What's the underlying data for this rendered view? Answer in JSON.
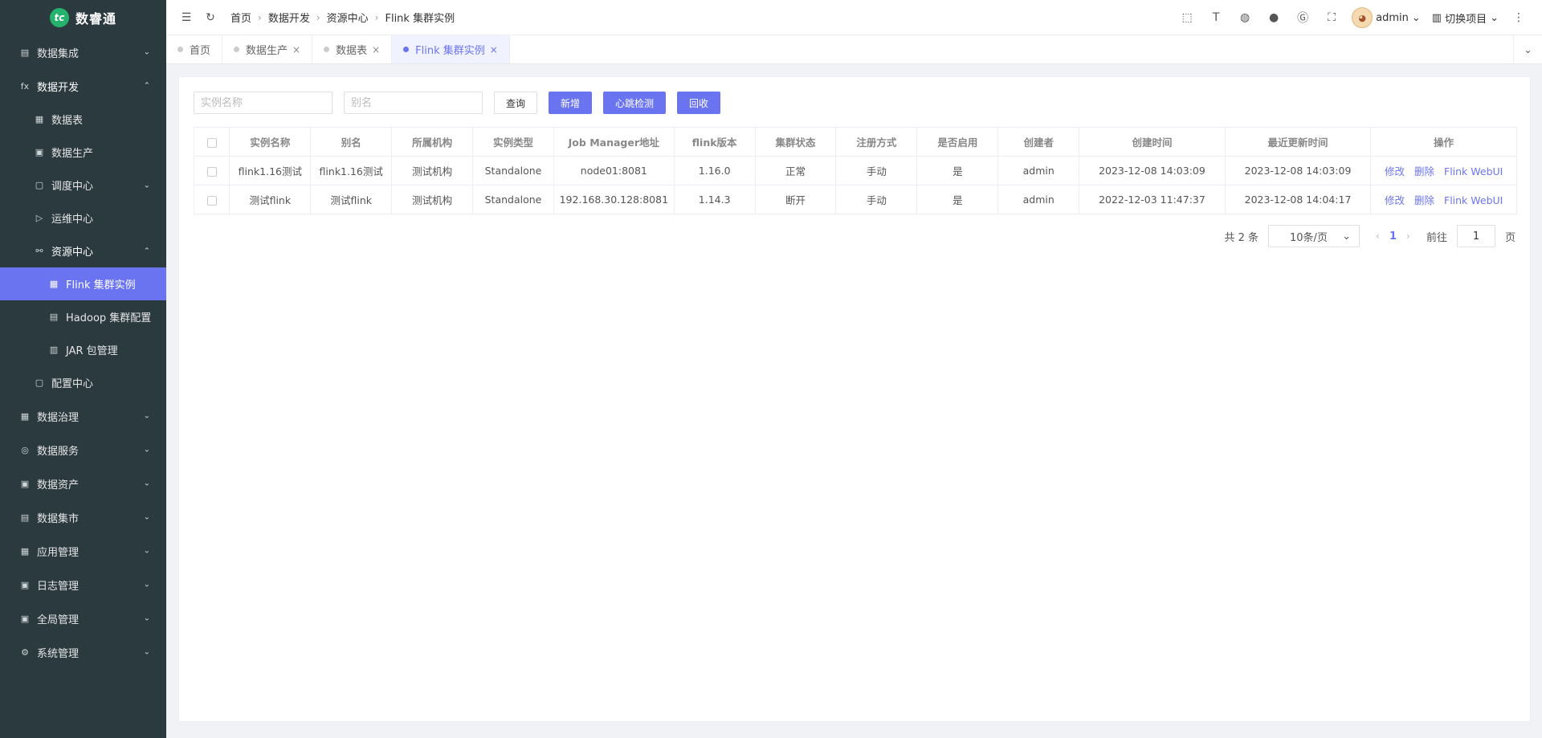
{
  "app": {
    "logo_mark": "tc",
    "name": "数睿通"
  },
  "sidebar": {
    "items": [
      {
        "label": "数据集成",
        "icon": "grid-icon",
        "glyph": "▤",
        "level": 1,
        "chevron": "down"
      },
      {
        "label": "数据开发",
        "icon": "function-icon",
        "glyph": "fx",
        "level": 1,
        "chevron": "up",
        "open": true
      },
      {
        "label": "数据表",
        "icon": "table-icon",
        "glyph": "▦",
        "level": 2
      },
      {
        "label": "数据生产",
        "icon": "monitor-icon",
        "glyph": "▣",
        "level": 2
      },
      {
        "label": "调度中心",
        "icon": "calendar-icon",
        "glyph": "▢",
        "level": 2,
        "chevron": "down"
      },
      {
        "label": "运维中心",
        "icon": "send-icon",
        "glyph": "▷",
        "level": 2
      },
      {
        "label": "资源中心",
        "icon": "share-icon",
        "glyph": "⚯",
        "level": 2,
        "chevron": "up",
        "open": true
      },
      {
        "label": "Flink 集群实例",
        "icon": "apps-icon",
        "glyph": "▦",
        "level": 3,
        "active": true
      },
      {
        "label": "Hadoop 集群配置",
        "icon": "table-icon",
        "glyph": "▤",
        "level": 3
      },
      {
        "label": "JAR 包管理",
        "icon": "package-icon",
        "glyph": "▥",
        "level": 3
      },
      {
        "label": "配置中心",
        "icon": "config-icon",
        "glyph": "▢",
        "level": 2
      },
      {
        "label": "数据治理",
        "icon": "grid-icon",
        "glyph": "▦",
        "level": 1,
        "chevron": "down"
      },
      {
        "label": "数据服务",
        "icon": "service-icon",
        "glyph": "◎",
        "level": 1,
        "chevron": "down"
      },
      {
        "label": "数据资产",
        "icon": "asset-icon",
        "glyph": "▣",
        "level": 1,
        "chevron": "down"
      },
      {
        "label": "数据集市",
        "icon": "market-icon",
        "glyph": "▤",
        "level": 1,
        "chevron": "down"
      },
      {
        "label": "应用管理",
        "icon": "apps-icon",
        "glyph": "▦",
        "level": 1,
        "chevron": "down"
      },
      {
        "label": "日志管理",
        "icon": "log-icon",
        "glyph": "▣",
        "level": 1,
        "chevron": "down"
      },
      {
        "label": "全局管理",
        "icon": "global-icon",
        "glyph": "▣",
        "level": 1,
        "chevron": "down"
      },
      {
        "label": "系统管理",
        "icon": "gear-icon",
        "glyph": "⚙",
        "level": 1,
        "chevron": "down"
      }
    ]
  },
  "topbar": {
    "breadcrumbs": [
      "首页",
      "数据开发",
      "资源中心",
      "Flink 集群实例"
    ],
    "user": "admin",
    "project": "切换项目"
  },
  "tabs": [
    {
      "label": "首页",
      "closable": false,
      "active": false
    },
    {
      "label": "数据生产",
      "closable": true,
      "active": false
    },
    {
      "label": "数据表",
      "closable": true,
      "active": false
    },
    {
      "label": "Flink 集群实例",
      "closable": true,
      "active": true
    }
  ],
  "search": {
    "name_placeholder": "实例名称",
    "alias_placeholder": "别名",
    "query_label": "查询",
    "add_label": "新增",
    "heartbeat_label": "心跳检测",
    "recycle_label": "回收"
  },
  "table": {
    "columns": [
      "实例名称",
      "别名",
      "所属机构",
      "实例类型",
      "Job Manager地址",
      "flink版本",
      "集群状态",
      "注册方式",
      "是否启用",
      "创建者",
      "创建时间",
      "最近更新时间",
      "操作"
    ],
    "rows": [
      [
        "flink1.16测试",
        "flink1.16测试",
        "测试机构",
        "Standalone",
        "node01:8081",
        "1.16.0",
        "正常",
        "手动",
        "是",
        "admin",
        "2023-12-08 14:03:09",
        "2023-12-08 14:03:09"
      ],
      [
        "测试flink",
        "测试flink",
        "测试机构",
        "Standalone",
        "192.168.30.128:8081",
        "1.14.3",
        "断开",
        "手动",
        "是",
        "admin",
        "2022-12-03 11:47:37",
        "2023-12-08 14:04:17"
      ]
    ],
    "actions": [
      "修改",
      "删除",
      "Flink WebUI"
    ]
  },
  "pagination": {
    "total_text": "共 2 条",
    "page_size": "10条/页",
    "current_page": "1",
    "goto_label": "前往",
    "goto_value": "1",
    "page_suffix": "页"
  },
  "colors": {
    "accent": "#6b74f0",
    "sidebar_bg": "#2b3a3f",
    "logo": "#25b26d"
  }
}
